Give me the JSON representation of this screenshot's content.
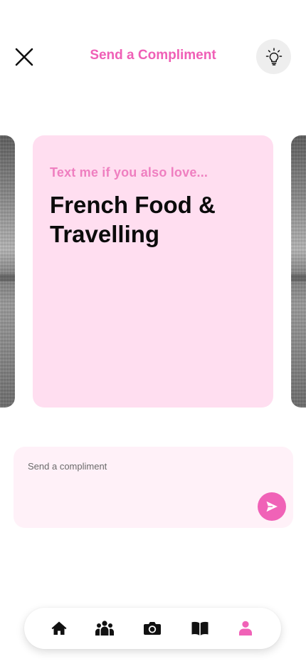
{
  "header": {
    "title": "Send a Compliment",
    "close_icon": "close-icon",
    "tips_icon": "lightbulb-icon"
  },
  "card": {
    "prompt": "Text me if you also love...",
    "answer": "French Food & Travelling",
    "background": "#ffdef0"
  },
  "compose": {
    "placeholder": "Send a compliment",
    "value": "",
    "send_icon": "send-icon"
  },
  "nav": {
    "items": [
      {
        "icon": "home-icon",
        "active": false
      },
      {
        "icon": "people-icon",
        "active": false
      },
      {
        "icon": "camera-icon",
        "active": false
      },
      {
        "icon": "book-icon",
        "active": false
      },
      {
        "icon": "profile-icon",
        "active": true
      }
    ]
  },
  "colors": {
    "accent": "#f062b7",
    "title": "#ef5fb6",
    "prompt": "#ef7fc0",
    "compose_bg": "#fff1f8"
  }
}
